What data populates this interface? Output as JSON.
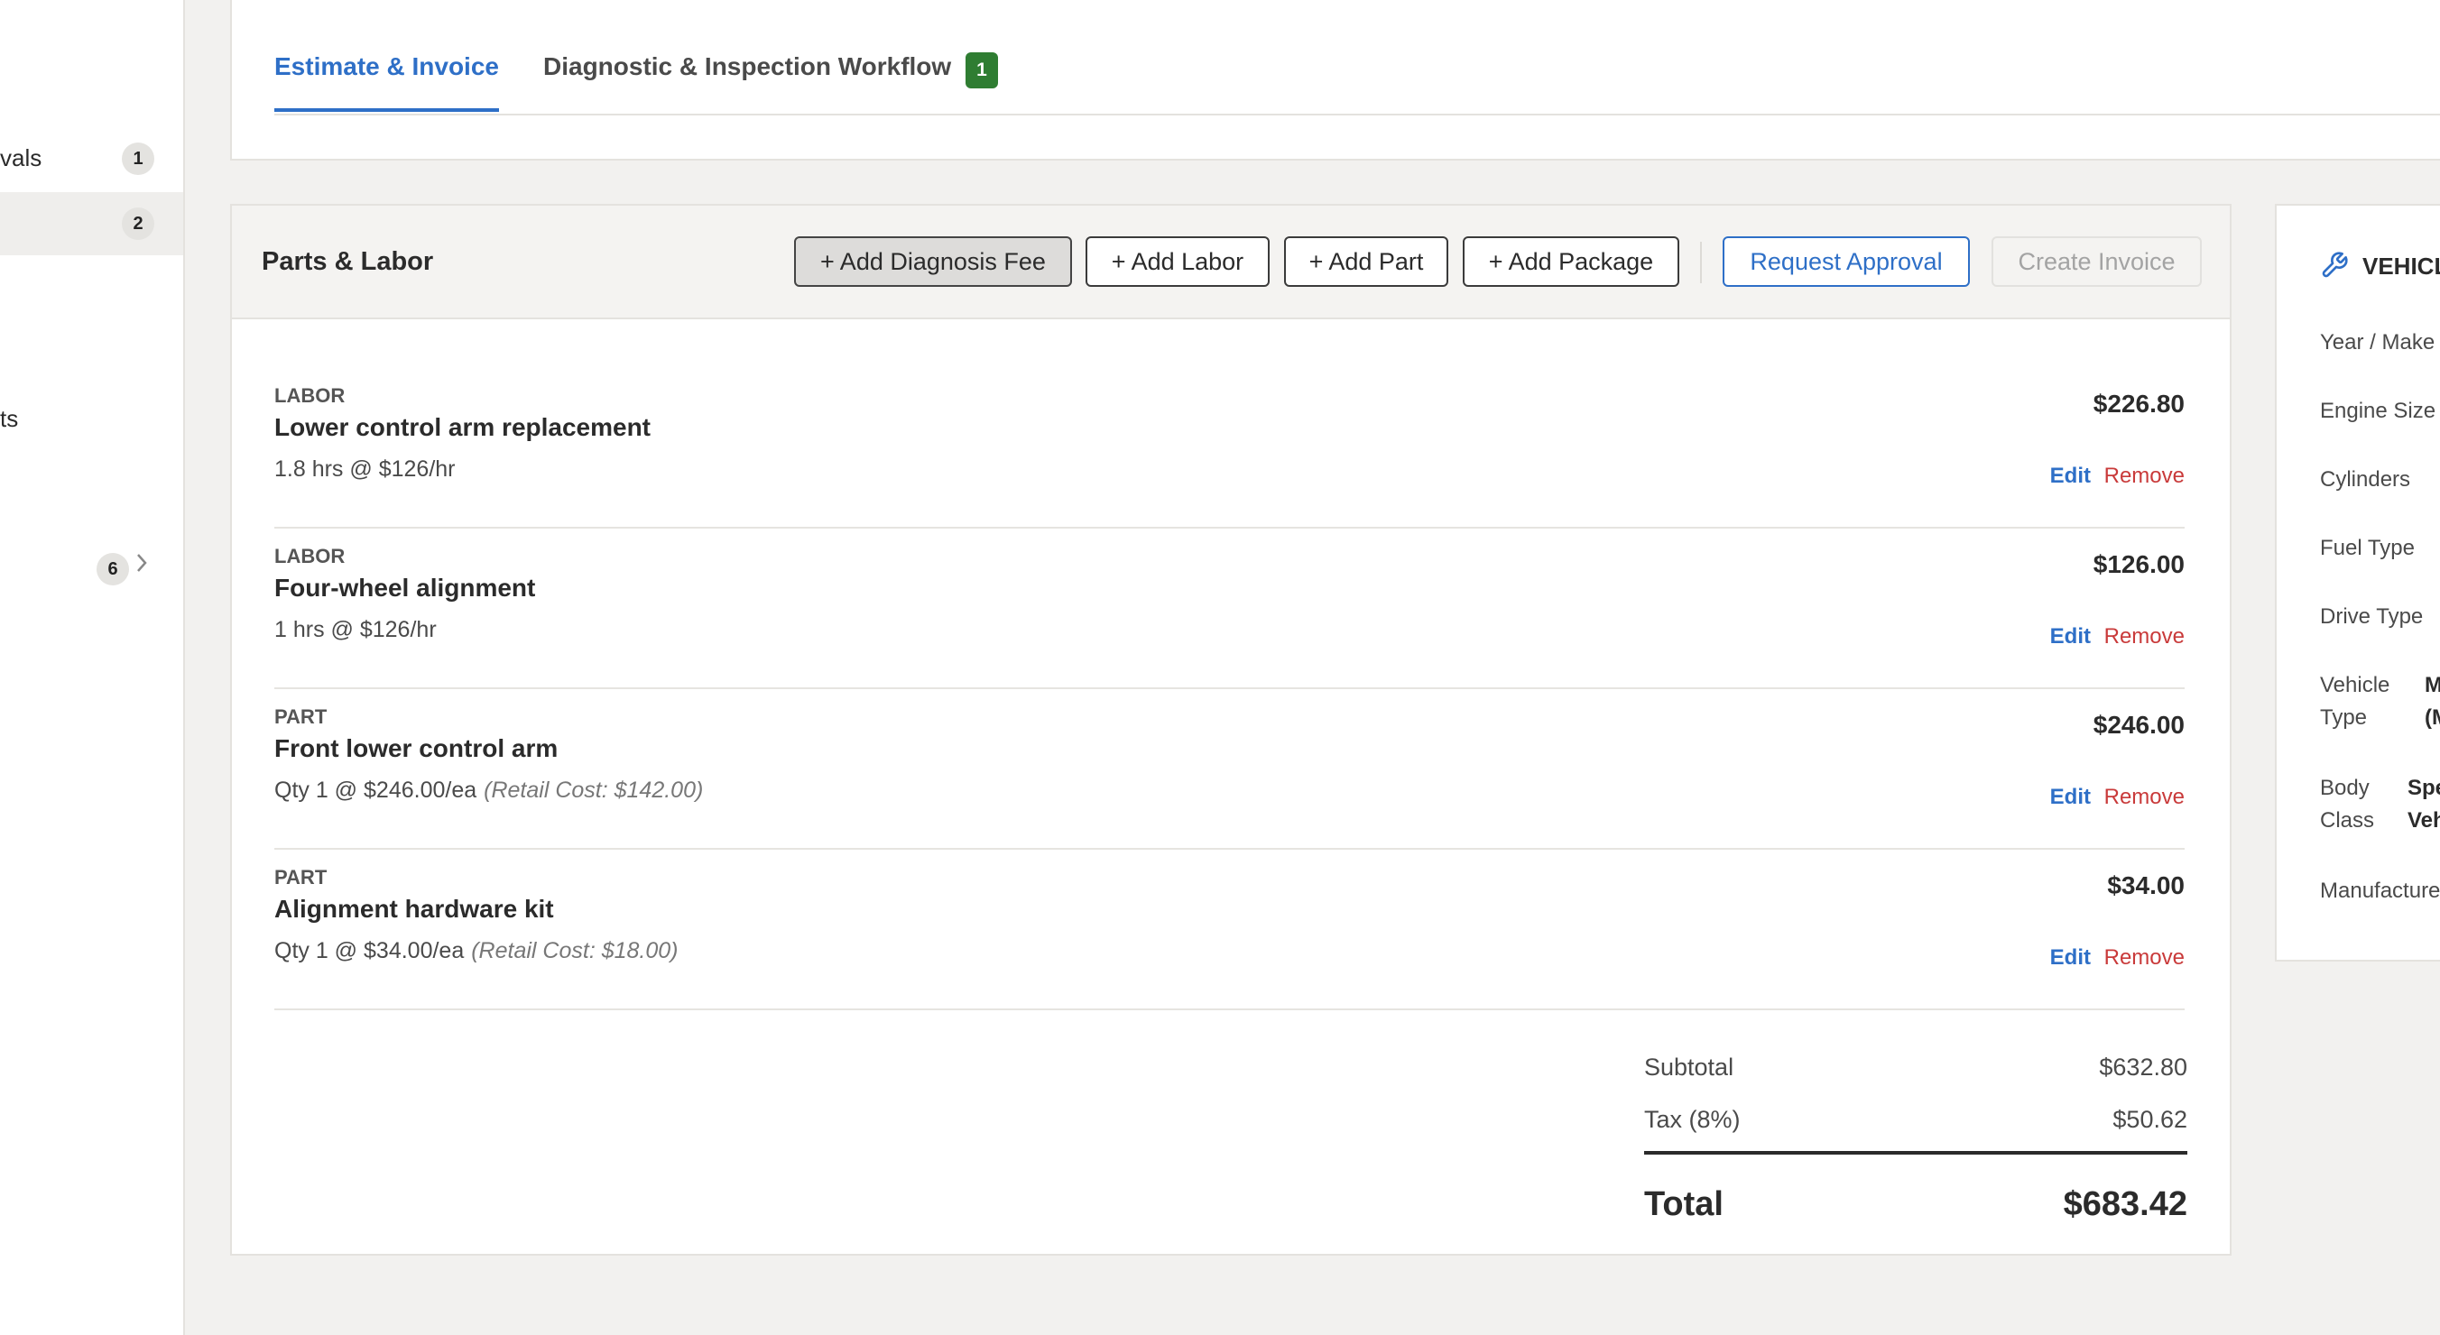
{
  "sidebar": {
    "items": [
      {
        "label": "vals",
        "badge": "1"
      },
      {
        "label": "",
        "badge": "2"
      },
      {
        "label": "ts",
        "badge": ""
      },
      {
        "label": "",
        "badge": "6"
      }
    ]
  },
  "tabs": [
    {
      "label": "Estimate & Invoice",
      "active": true
    },
    {
      "label": "Diagnostic & Inspection Workflow",
      "badge": "1",
      "active": false
    }
  ],
  "parts_labor": {
    "title": "Parts & Labor",
    "buttons": {
      "add_diagnosis_fee": "+ Add Diagnosis Fee",
      "add_labor": "+ Add Labor",
      "add_part": "+ Add Part",
      "add_package": "+ Add Package",
      "request_approval": "Request Approval",
      "create_invoice": "Create Invoice"
    },
    "items": [
      {
        "type": "LABOR",
        "name": "Lower control arm replacement",
        "detail": "1.8 hrs @ $126/hr",
        "retail": "",
        "price": "$226.80",
        "edit": "Edit",
        "remove": "Remove"
      },
      {
        "type": "LABOR",
        "name": "Four-wheel alignment",
        "detail": "1 hrs @ $126/hr",
        "retail": "",
        "price": "$126.00",
        "edit": "Edit",
        "remove": "Remove"
      },
      {
        "type": "PART",
        "name": "Front lower control arm",
        "detail": "Qty 1 @ $246.00/ea",
        "retail": "(Retail Cost: $142.00)",
        "price": "$246.00",
        "edit": "Edit",
        "remove": "Remove"
      },
      {
        "type": "PART",
        "name": "Alignment hardware kit",
        "detail": "Qty 1 @ $34.00/ea",
        "retail": "(Retail Cost: $18.00)",
        "price": "$34.00",
        "edit": "Edit",
        "remove": "Remove"
      }
    ],
    "totals": {
      "subtotal_label": "Subtotal",
      "subtotal": "$632.80",
      "tax_label": "Tax (8%)",
      "tax": "$50.62",
      "total_label": "Total",
      "total": "$683.42"
    }
  },
  "vehicle": {
    "title": "VEHICL",
    "rows": [
      {
        "label": "Year / Make ,",
        "value": ""
      },
      {
        "label": "Engine Size",
        "value": ""
      },
      {
        "label": "Cylinders",
        "value": ""
      },
      {
        "label": "Fuel Type",
        "value": ""
      },
      {
        "label": "Drive Type",
        "value": ""
      },
      {
        "label": "Vehicle\nType",
        "value": "M\n(M"
      },
      {
        "label": "Body\nClass",
        "value": "Spe\nVeh"
      },
      {
        "label": "Manufacture",
        "value": ""
      }
    ]
  },
  "colors": {
    "accent": "#2e6fc7",
    "danger": "#c93a3a",
    "badge_green": "#2f7d32",
    "background": "#f2f1ef"
  }
}
